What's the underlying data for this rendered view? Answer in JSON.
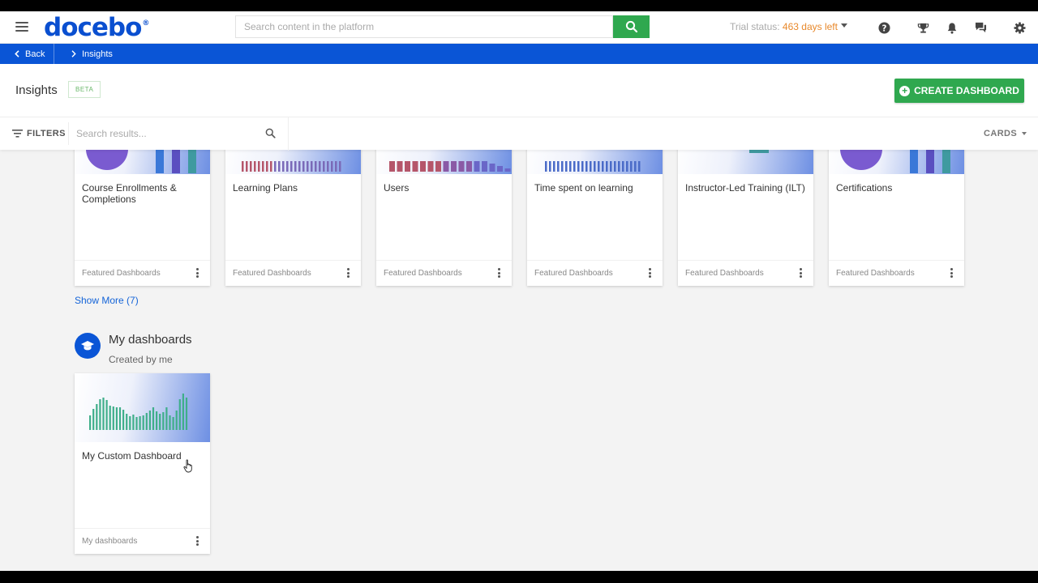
{
  "header": {
    "logo": "docebo",
    "logo_mark": "®",
    "search_placeholder": "Search content in the platform",
    "trial_label": "Trial status:",
    "trial_days": "463 days left"
  },
  "icons": {
    "menu": "hamburger-icon",
    "search": "search-icon",
    "help": "help-icon",
    "trophy": "trophy-icon",
    "bell": "bell-icon",
    "chat": "chat-icon",
    "settings": "gear-icon"
  },
  "crumbs": {
    "back": "Back",
    "current": "Insights"
  },
  "page": {
    "title": "Insights",
    "badge": "BETA",
    "create_button": "CREATE DASHBOARD"
  },
  "filterbar": {
    "filters_label": "FILTERS",
    "search_placeholder": "Search results...",
    "view_mode": "CARDS"
  },
  "featured_cards": [
    {
      "title": "Course Enrollments & Completions",
      "category": "Featured Dashboards"
    },
    {
      "title": "Learning Plans",
      "category": "Featured Dashboards"
    },
    {
      "title": "Users",
      "category": "Featured Dashboards"
    },
    {
      "title": "Time spent on learning",
      "category": "Featured Dashboards"
    },
    {
      "title": "Instructor-Led Training (ILT)",
      "category": "Featured Dashboards"
    },
    {
      "title": "Certifications",
      "category": "Featured Dashboards"
    }
  ],
  "show_more": "Show More (7)",
  "my_section": {
    "title": "My dashboards",
    "subtitle": "Created by me"
  },
  "my_cards": [
    {
      "title": "My Custom Dashboard",
      "category": "My dashboards"
    }
  ],
  "colors": {
    "brand_blue": "#0a55d6",
    "accent_green": "#2fa84f",
    "trial_orange": "#e8892c"
  }
}
